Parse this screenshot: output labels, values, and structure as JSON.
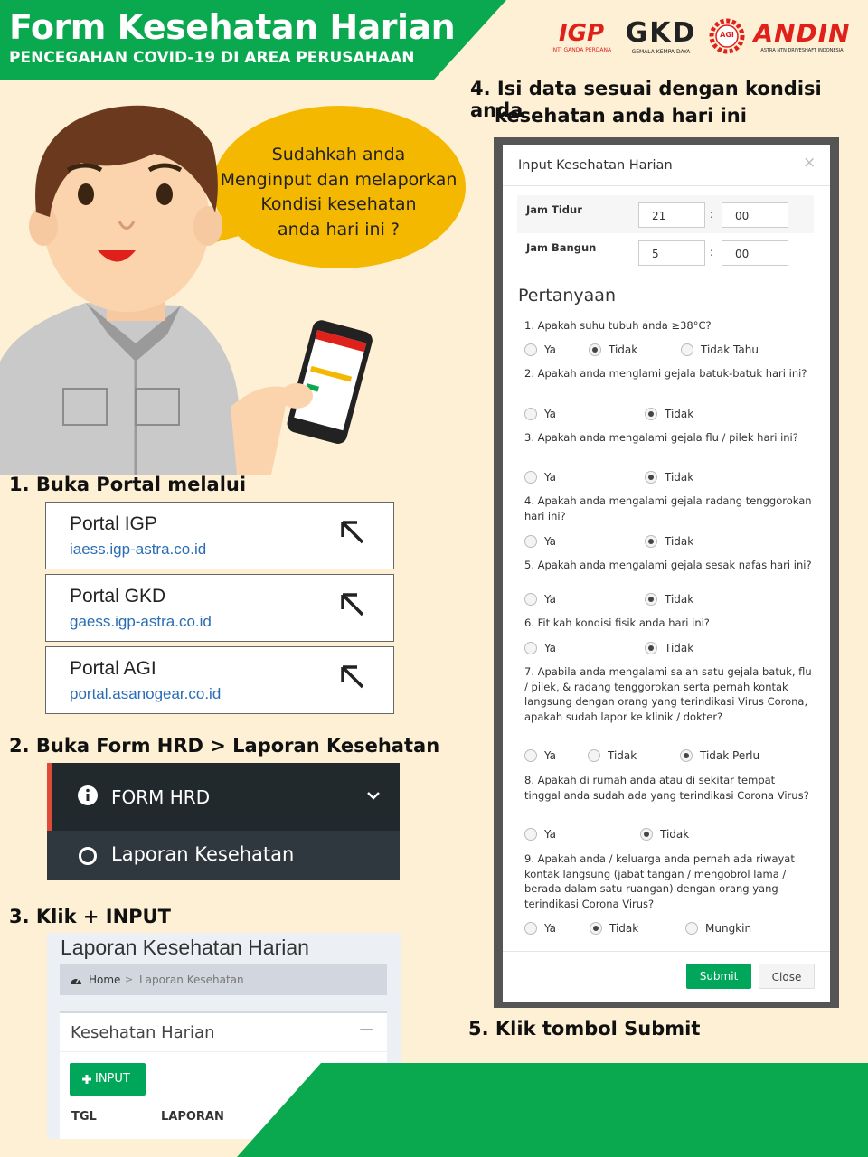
{
  "header": {
    "title": "Form Kesehatan Harian",
    "subtitle": "PENCEGAHAN COVID-19 DI AREA PERUSAHAAN"
  },
  "logos": {
    "igp": "IGP",
    "igp_sub": "INTI GANDA PERDANA",
    "gkd": "GKD",
    "gkd_sub": "GEMALA KEMPA DAYA",
    "agi": "AGI",
    "andin": "ANDIN",
    "andin_sub": "ASTRA NTN DRIVESHAFT INDONESIA"
  },
  "bubble": {
    "line1": "Sudahkah anda",
    "line2": "Menginput dan melaporkan",
    "line3": "Kondisi kesehatan",
    "line4": "anda hari ini ?"
  },
  "steps": {
    "s1": "1. Buka Portal melalui",
    "s2": "2. Buka Form HRD > Laporan Kesehatan",
    "s3": "3. Klik + INPUT",
    "s4_line1": "4. Isi data sesuai dengan kondisi anda",
    "s4_line2": "kesehatan anda hari ini",
    "s5": "5. Klik tombol Submit"
  },
  "portals": [
    {
      "name": "Portal IGP",
      "url": "iaess.igp-astra.co.id"
    },
    {
      "name": "Portal GKD",
      "url": "gaess.igp-astra.co.id"
    },
    {
      "name": "Portal AGI",
      "url": "portal.asanogear.co.id"
    }
  ],
  "menu": {
    "form_hrd": "FORM HRD",
    "laporan": "Laporan Kesehatan"
  },
  "laporan_page": {
    "title": "Laporan Kesehatan Harian",
    "breadcrumb_home": "Home",
    "breadcrumb_sep": ">",
    "breadcrumb_current": "Laporan Kesehatan",
    "box_title": "Kesehatan Harian",
    "collapse": "−",
    "input_button": "INPUT",
    "col_tgl": "TGL",
    "col_laporan": "LAPORAN"
  },
  "modal": {
    "title": "Input Kesehatan Harian",
    "close_x": "×",
    "jam_tidur_label": "Jam Tidur",
    "jam_tidur_h": "21",
    "jam_tidur_m": "00",
    "jam_bangun_label": "Jam Bangun",
    "jam_bangun_h": "5",
    "jam_bangun_m": "00",
    "colon": ":",
    "section": "Pertanyaan",
    "q1": "1. Apakah suhu tubuh anda ≥38°C?",
    "q2": "2. Apakah anda menglami gejala batuk-batuk hari ini?",
    "q3": "3. Apakah anda mengalami gejala flu / pilek hari ini?",
    "q4": "4. Apakah anda mengalami gejala radang tenggorokan hari ini?",
    "q5": "5. Apakah anda mengalami gejala sesak nafas hari ini?",
    "q6": "6. Fit kah kondisi fisik anda hari ini?",
    "q7": "7. Apabila anda mengalami salah satu gejala batuk, flu / pilek, & radang tenggorokan serta pernah kontak langsung dengan orang yang terindikasi Virus Corona, apakah sudah lapor ke klinik / dokter?",
    "q8": "8. Apakah di rumah anda atau di sekitar tempat tinggal anda sudah ada yang terindikasi Corona Virus?",
    "q9": "9. Apakah anda / keluarga anda pernah ada riwayat kontak langsung (jabat tangan / mengobrol lama / berada dalam satu ruangan) dengan orang yang terindikasi Corona Virus?",
    "opt_ya": "Ya",
    "opt_tidak": "Tidak",
    "opt_tidak_tahu": "Tidak Tahu",
    "opt_tidak_perlu": "Tidak Perlu",
    "opt_mungkin": "Mungkin",
    "submit": "Submit",
    "close": "Close"
  },
  "colors": {
    "green": "#0aa84f",
    "cream": "#fdf0d5",
    "bubble": "#f5b800",
    "red": "#e0201b"
  }
}
